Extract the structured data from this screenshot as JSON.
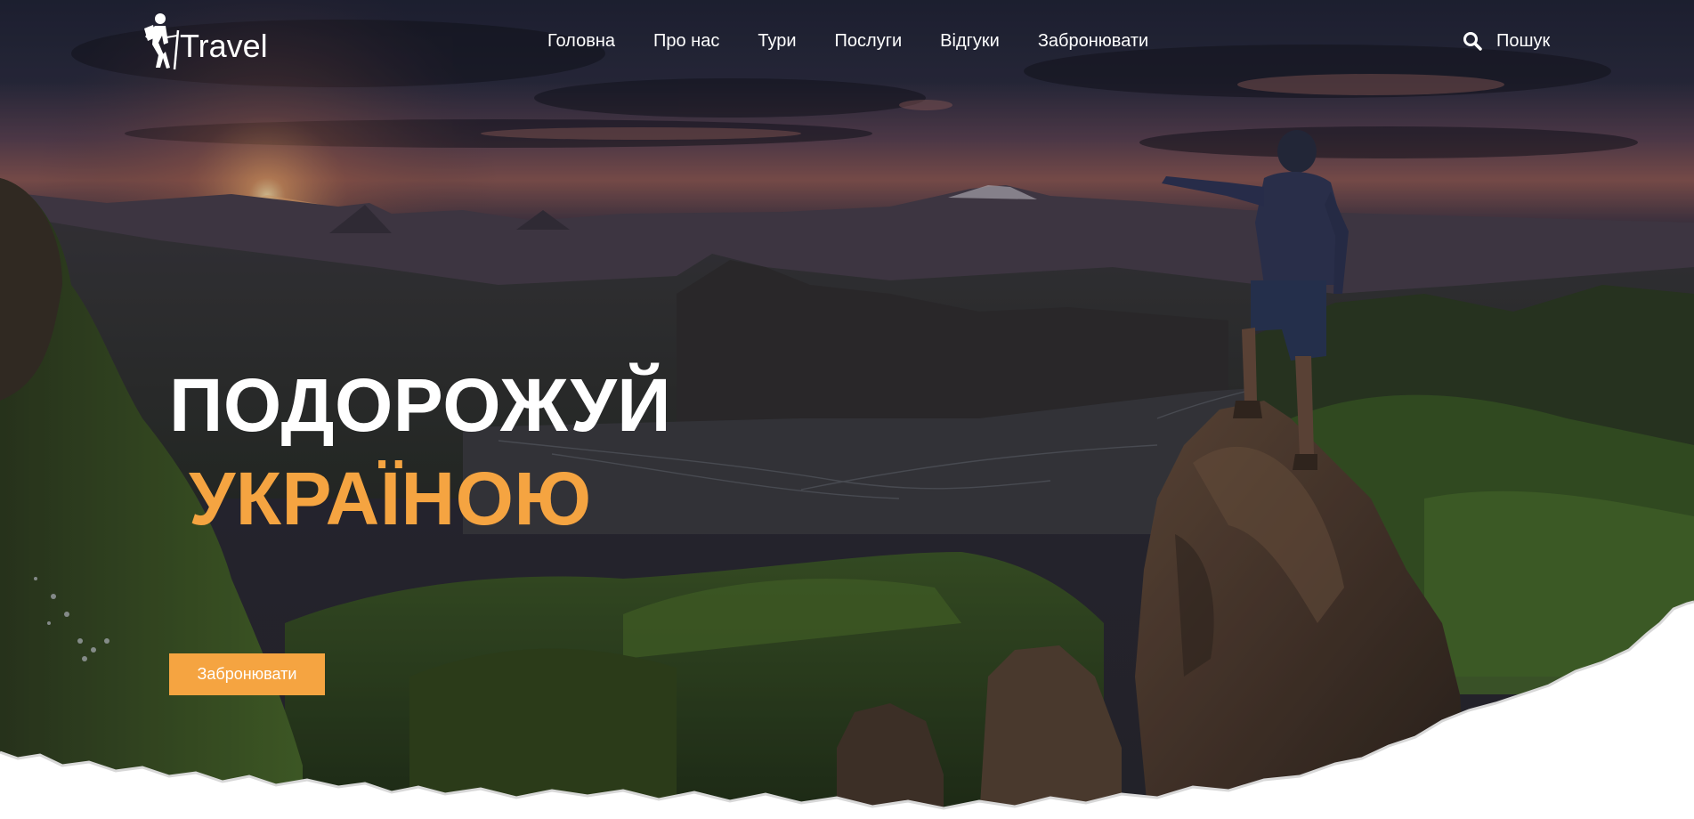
{
  "colors": {
    "accent": "#f5a441",
    "text_light": "#ffffff",
    "page_bg": "#ffffff"
  },
  "header": {
    "logo_text": "Travel",
    "logo_icon": "hiker-icon",
    "nav": [
      {
        "label": "Головна"
      },
      {
        "label": "Про нас"
      },
      {
        "label": "Тури"
      },
      {
        "label": "Послуги"
      },
      {
        "label": "Відгуки"
      },
      {
        "label": "Забронювати"
      }
    ],
    "search": {
      "label": "Пошук",
      "icon": "search-icon"
    }
  },
  "hero": {
    "headline_line1": "ПОДОРОЖУЙ",
    "headline_line2": "УКРАЇНОЮ",
    "cta_label": "Забронювати",
    "background": "mountain-sunset-photo"
  }
}
